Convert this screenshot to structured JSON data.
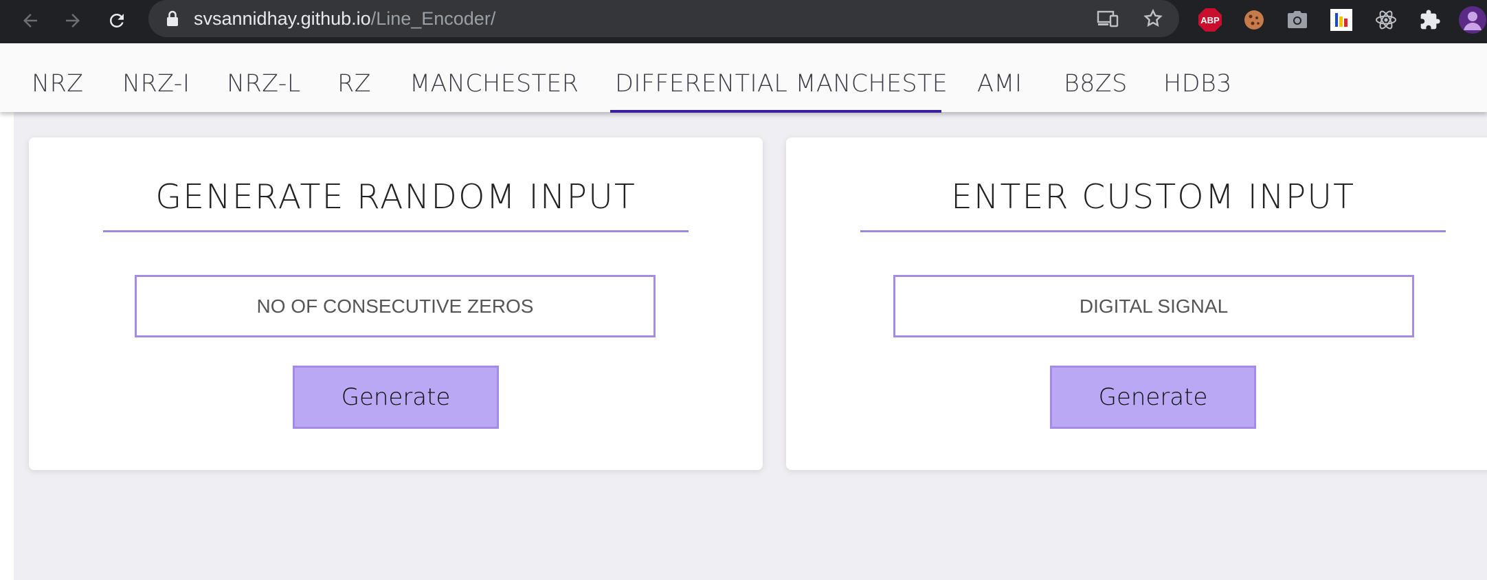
{
  "browser": {
    "url_host": "svsannidhay.github.io",
    "url_path": "/Line_Encoder/",
    "extensions": [
      "abp-extension-icon",
      "cookie-extension-icon",
      "camera-extension-icon",
      "colorful-extension-icon",
      "react-devtools-icon",
      "extensions-puzzle-icon",
      "profile-avatar"
    ],
    "abp_label": "ABP"
  },
  "tabs": [
    {
      "label": "NRZ"
    },
    {
      "label": "NRZ-I"
    },
    {
      "label": "NRZ-L"
    },
    {
      "label": "RZ"
    },
    {
      "label": "MANCHESTER"
    },
    {
      "label": "DIFFERENTIAL MANCHESTE",
      "active": true
    },
    {
      "label": "AMI"
    },
    {
      "label": "B8ZS"
    },
    {
      "label": "HDB3"
    }
  ],
  "random_card": {
    "title": "GENERATE RANDOM INPUT",
    "input_placeholder": "NO OF CONSECUTIVE ZEROS",
    "button_label": "Generate"
  },
  "custom_card": {
    "title": "ENTER CUSTOM INPUT",
    "input_placeholder": "DIGITAL SIGNAL",
    "button_label": "Generate"
  },
  "colors": {
    "accent": "#a38be6",
    "button_fill": "#bba8f4",
    "active_tab_underline": "#3a1ea0",
    "chrome_bg": "#202124"
  }
}
